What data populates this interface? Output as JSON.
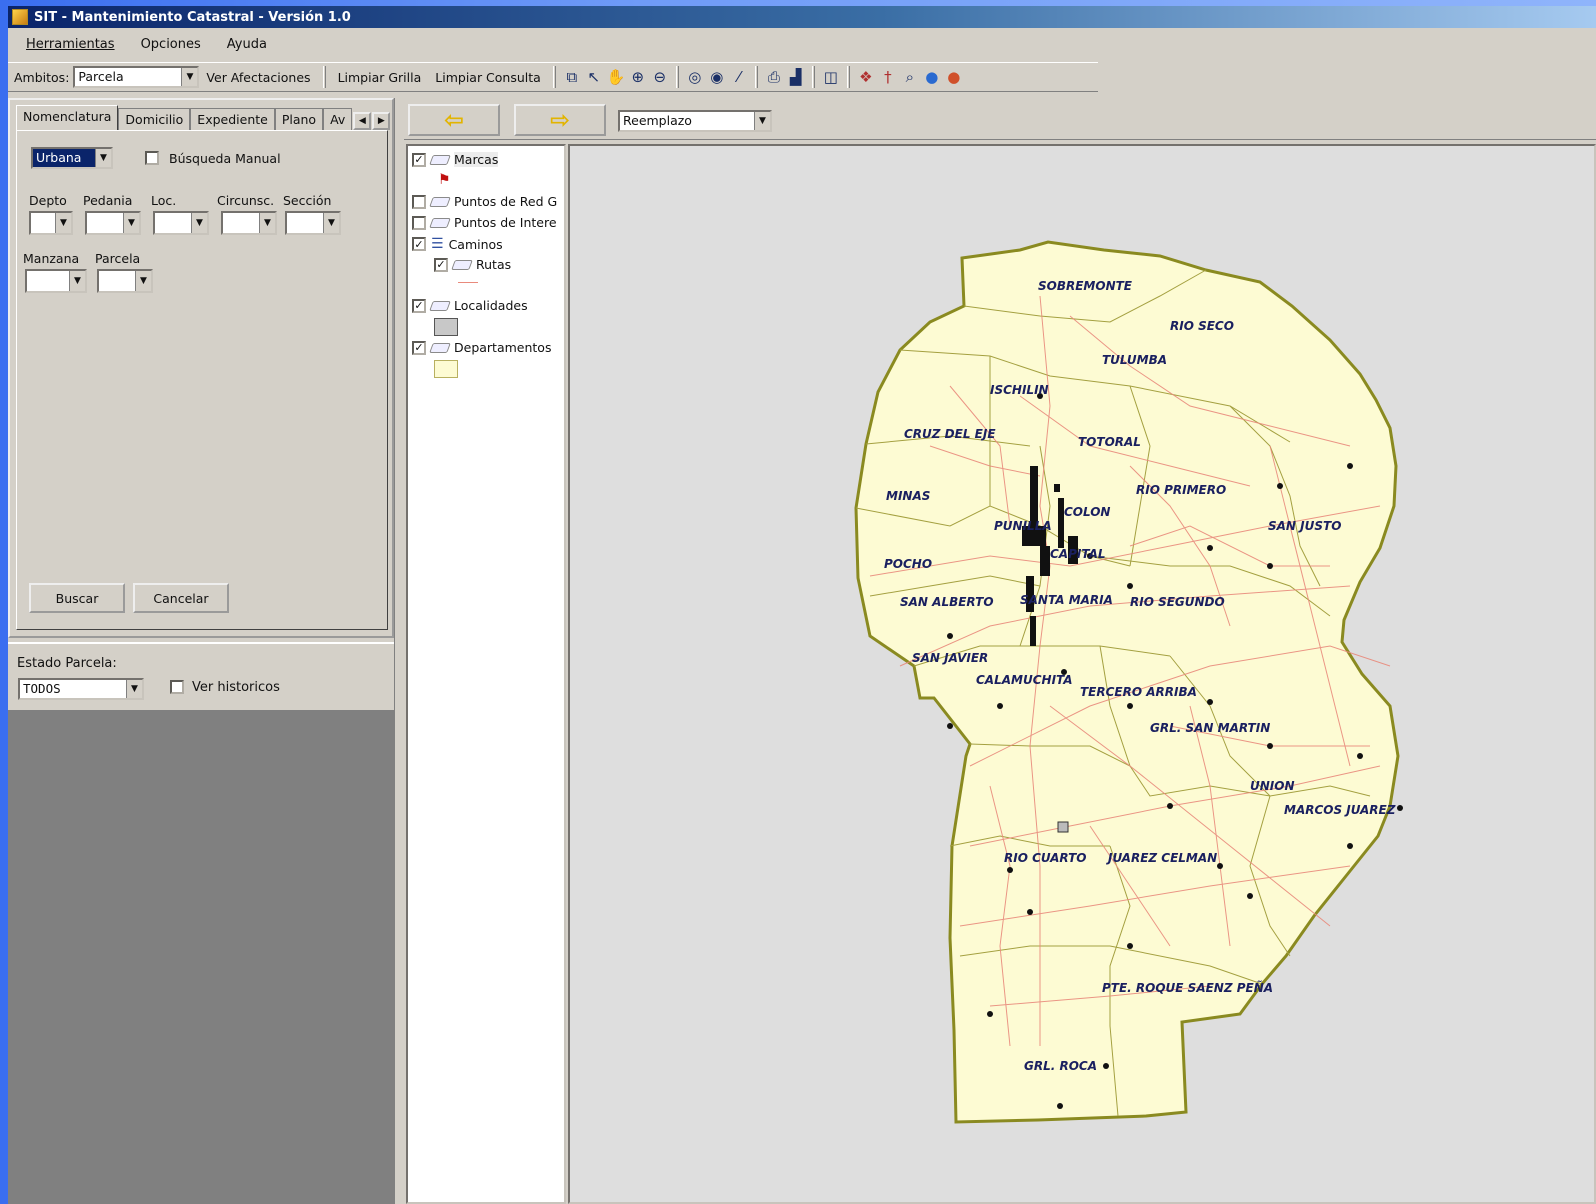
{
  "window": {
    "title": "SIT - Mantenimiento Catastral - Versión 1.0"
  },
  "menu": {
    "items": [
      "Herramientas",
      "Opciones",
      "Ayuda"
    ]
  },
  "toolbar": {
    "ambitos_label": "Ambitos:",
    "ambitos_value": "Parcela",
    "ver_afectaciones": "Ver Afectaciones",
    "limpiar_grilla": "Limpiar Grilla",
    "limpiar_consulta": "Limpiar Consulta",
    "icons": [
      "copy-icon",
      "pointer-icon",
      "pan-hand-icon",
      "zoom-in-icon",
      "zoom-out-icon",
      "zoom-previous-icon",
      "zoom-next-icon",
      "measure-icon",
      "print-icon",
      "chart-icon",
      "columns-icon",
      "layers-icon",
      "pin-icon",
      "search-icon",
      "globe-icon",
      "world-icon"
    ]
  },
  "tabs": [
    "Nomenclatura",
    "Domicilio",
    "Expediente",
    "Plano",
    "Av"
  ],
  "nomenclatura": {
    "tipo_value": "Urbana",
    "busqueda_manual": "Búsqueda Manual",
    "labels_row1": [
      "Depto",
      "Pedania",
      "Loc.",
      "Circunsc.",
      "Sección"
    ],
    "labels_row2": [
      "Manzana",
      "Parcela"
    ],
    "buscar": "Buscar",
    "cancelar": "Cancelar"
  },
  "estado": {
    "label": "Estado Parcela:",
    "value": "TODOS",
    "ver_historicos": "Ver historicos"
  },
  "navigation": {
    "mode_value": "Reemplazo"
  },
  "layers": [
    {
      "name": "Marcas",
      "checked": true
    },
    {
      "name": "Puntos de Red G",
      "checked": false
    },
    {
      "name": "Puntos de Intere",
      "checked": false
    },
    {
      "name": "Caminos",
      "checked": true
    },
    {
      "name": "Rutas",
      "checked": true
    },
    {
      "name": "Localidades",
      "checked": true
    },
    {
      "name": "Departamentos",
      "checked": true
    }
  ],
  "colors": {
    "map_fill": "#fdfbd3",
    "map_border": "#8a8a20",
    "roads": "#e98a7c",
    "map_background": "#dedede"
  },
  "map": {
    "departments": [
      "SOBREMONTE",
      "RIO SECO",
      "TULUMBA",
      "ISCHILIN",
      "CRUZ DEL EJE",
      "TOTORAL",
      "MINAS",
      "RIO PRIMERO",
      "COLON",
      "PUNILLA",
      "SAN JUSTO",
      "POCHO",
      "CAPITAL",
      "SAN ALBERTO",
      "SANTA MARIA",
      "RIO SEGUNDO",
      "SAN JAVIER",
      "CALAMUCHITA",
      "TERCERO ARRIBA",
      "GRL. SAN MARTIN",
      "UNION",
      "MARCOS JUAREZ",
      "RIO CUARTO",
      "JUAREZ CELMAN",
      "PTE. ROQUE SAENZ PEÑA",
      "GRL. ROCA"
    ]
  }
}
